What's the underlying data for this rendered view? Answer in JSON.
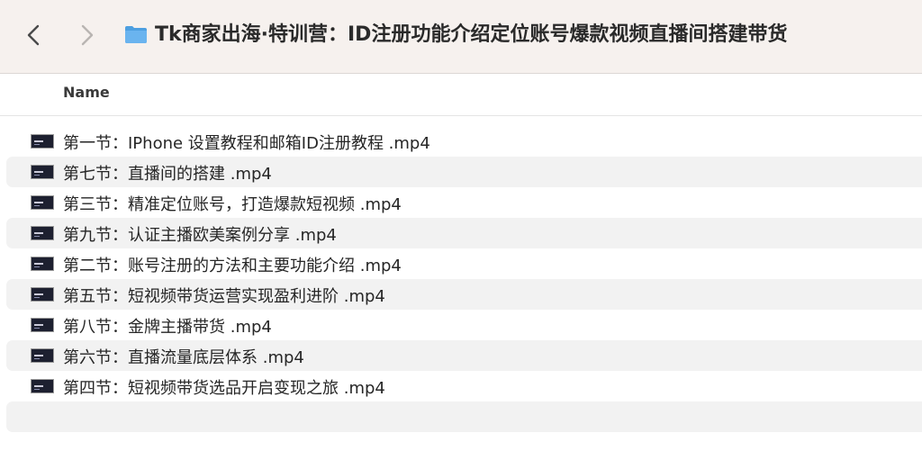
{
  "window": {
    "title": "Tk商家出海·特训营：ID注册功能介绍定位账号爆款视频直播间搭建带货"
  },
  "toolbar": {
    "back_icon": "chevron-left-icon",
    "forward_icon": "chevron-right-icon",
    "folder_icon": "folder-icon",
    "folder_color": "#5aa9e8"
  },
  "columns": {
    "name": "Name"
  },
  "files": [
    {
      "name": "第一节：IPhone 设置教程和邮箱ID注册教程 .mp4"
    },
    {
      "name": "第七节：直播间的搭建 .mp4"
    },
    {
      "name": "第三节：精准定位账号，打造爆款短视频 .mp4"
    },
    {
      "name": "第九节：认证主播欧美案例分享 .mp4"
    },
    {
      "name": "第二节：账号注册的方法和主要功能介绍 .mp4"
    },
    {
      "name": "第五节：短视频带货运营实现盈利进阶 .mp4"
    },
    {
      "name": "第八节：金牌主播带货 .mp4"
    },
    {
      "name": "第六节：直播流量底层体系 .mp4"
    },
    {
      "name": "第四节：短视频带货选品开启变现之旅 .mp4"
    }
  ]
}
